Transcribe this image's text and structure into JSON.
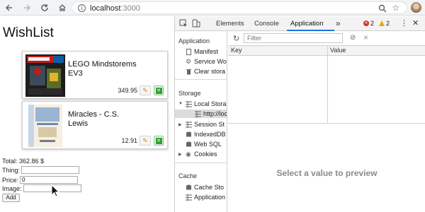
{
  "browser": {
    "url_host": "localhost",
    "url_port": ":3000"
  },
  "page": {
    "title": "WishList",
    "items": [
      {
        "name": "LEGO Mindstorems EV3",
        "price": "349.95"
      },
      {
        "name": "Miracles - C.S. Lewis",
        "price": "12.91"
      }
    ],
    "total_label": "Total:",
    "total_value": "362.86",
    "total_currency": "$",
    "thing_label": "Thing:",
    "thing_value": "",
    "price_label": "Price:",
    "price_value": "0",
    "image_label": "Image:",
    "image_value": "",
    "add_label": "Add"
  },
  "devtools": {
    "tabs": [
      "Elements",
      "Console",
      "Application"
    ],
    "more": "»",
    "errors": "2",
    "warnings": "2",
    "sidebar": {
      "application_head": "Application",
      "manifest": "Manifest",
      "service_workers": "Service Wo",
      "clear_storage": "Clear stora",
      "storage_head": "Storage",
      "local_storage": "Local Stora",
      "local_origin": "http://loc",
      "session_storage": "Session St",
      "indexeddb": "IndexedDB",
      "web_sql": "Web SQL",
      "cookies": "Cookies",
      "cache_head": "Cache",
      "cache_storage": "Cache Sto",
      "app_cache": "Application"
    },
    "filter_placeholder": "Filter",
    "col_key": "Key",
    "col_value": "Value",
    "preview_text": "Select a value to preview"
  },
  "colors": {
    "accent": "#1a73e8",
    "error": "#d93025",
    "warning": "#f2a600",
    "delete_green": "#2fa12f"
  }
}
